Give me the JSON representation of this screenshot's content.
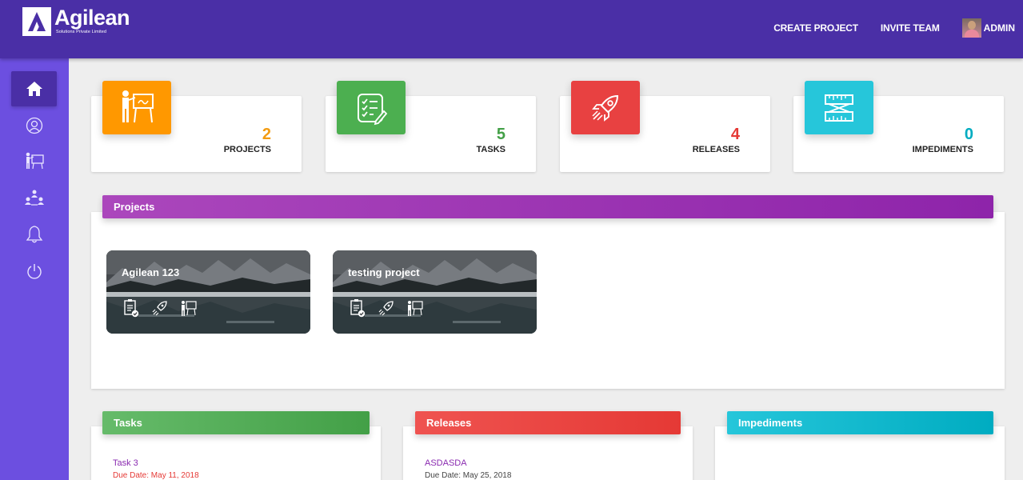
{
  "header": {
    "logo_name": "Agilean",
    "logo_sub": "Solutions Private Limited",
    "create_project": "CREATE PROJECT",
    "invite_team": "INVITE TEAM",
    "user": "ADMIN"
  },
  "sidebar": {
    "items": [
      {
        "icon": "home-icon"
      },
      {
        "icon": "user-icon"
      },
      {
        "icon": "presentation-icon"
      },
      {
        "icon": "team-icon"
      },
      {
        "icon": "bell-icon"
      },
      {
        "icon": "power-icon"
      }
    ]
  },
  "stats": [
    {
      "value": "2",
      "label": "PROJECTS",
      "color": "#f39c12",
      "icon": "presentation-icon"
    },
    {
      "value": "5",
      "label": "TASKS",
      "color": "#43a047",
      "icon": "checklist-icon"
    },
    {
      "value": "4",
      "label": "RELEASES",
      "color": "#e53935",
      "icon": "rocket-icon"
    },
    {
      "value": "0",
      "label": "IMPEDIMENTS",
      "color": "#00acc1",
      "icon": "ruler-icon"
    }
  ],
  "projects": {
    "header": "Projects",
    "cards": [
      {
        "title": "Agilean 123"
      },
      {
        "title": "testing project"
      }
    ]
  },
  "tasks": {
    "header": "Tasks",
    "items": [
      {
        "title": "Task 3",
        "due": "Due Date: May 11, 2018"
      }
    ]
  },
  "releases": {
    "header": "Releases",
    "items": [
      {
        "title": "ASDASDA",
        "due": "Due Date: May 25, 2018"
      }
    ]
  },
  "impediments": {
    "header": "Impediments"
  }
}
